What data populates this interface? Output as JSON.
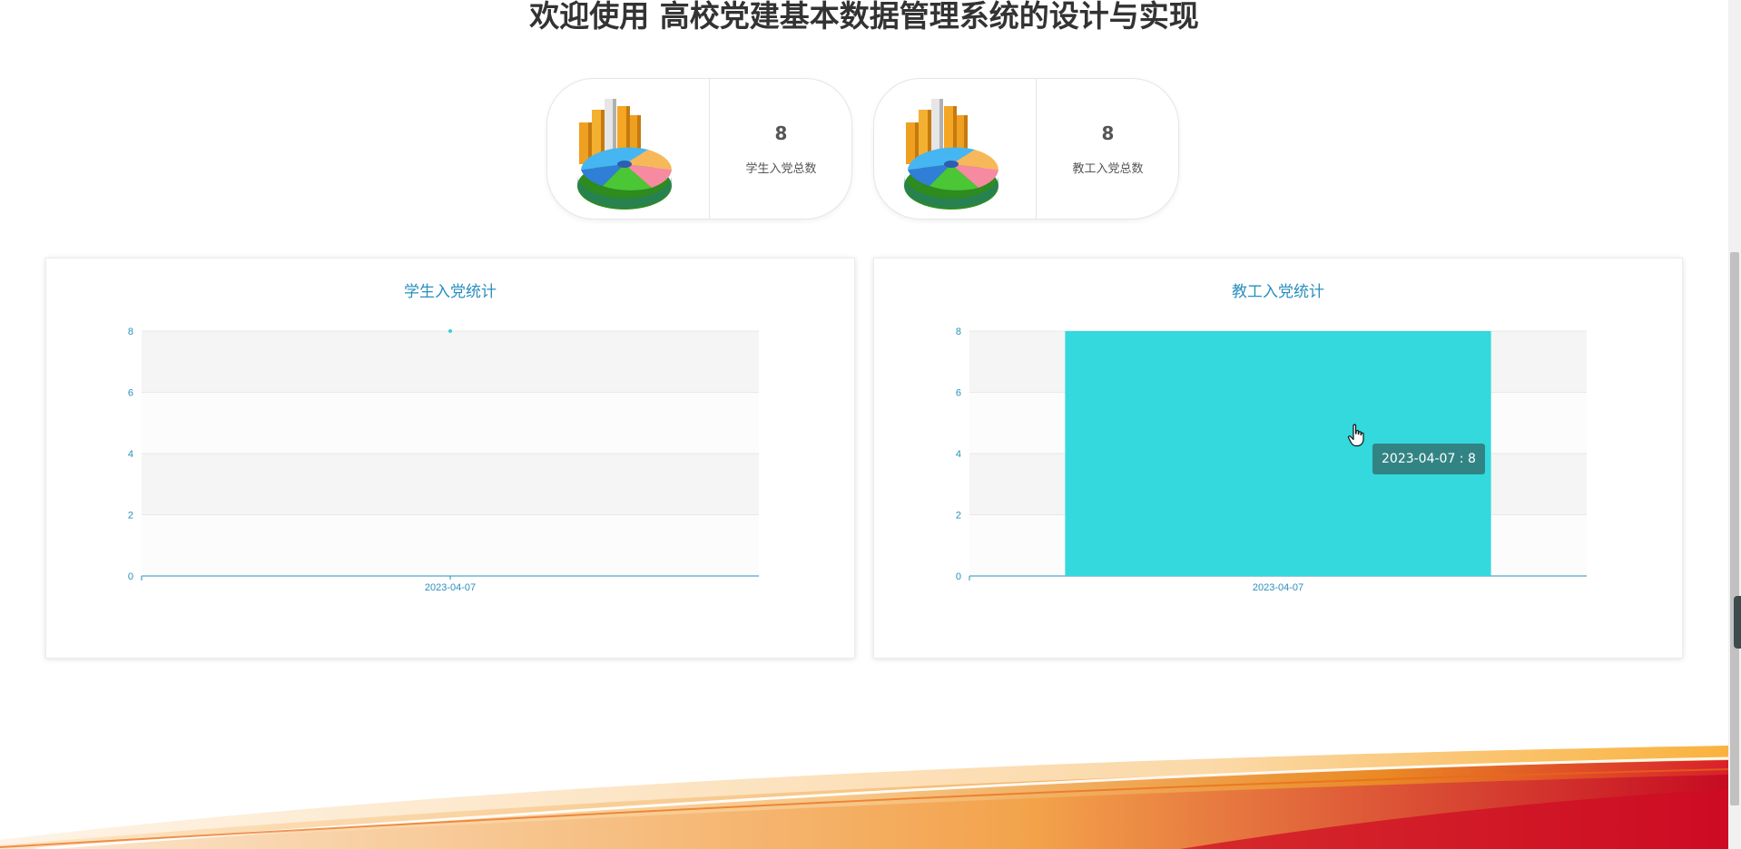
{
  "page": {
    "title": "欢迎使用 高校党建基本数据管理系统的设计与实现"
  },
  "stats": [
    {
      "value": "8",
      "label": "学生入党总数",
      "icon": "pie-bar-chart-icon"
    },
    {
      "value": "8",
      "label": "教工入党总数",
      "icon": "pie-bar-chart-icon"
    }
  ],
  "chart_data": [
    {
      "type": "line",
      "title": "学生入党统计",
      "categories": [
        "2023-04-07"
      ],
      "values": [
        8
      ],
      "ylim": [
        0,
        8
      ],
      "yticks": [
        "0",
        "2",
        "4",
        "6",
        "8"
      ],
      "grid": true,
      "color": "#33d1d6"
    },
    {
      "type": "bar",
      "title": "教工入党统计",
      "categories": [
        "2023-04-07"
      ],
      "values": [
        8
      ],
      "ylim": [
        0,
        8
      ],
      "yticks": [
        "0",
        "2",
        "4",
        "6",
        "8"
      ],
      "grid": true,
      "color": "#33d9dd"
    }
  ],
  "tooltip": {
    "text": "2023-04-07 : 8"
  },
  "colors": {
    "accent": "#2a8fbd",
    "bar": "#33d9dd",
    "tooltip_bg": "#327878"
  }
}
